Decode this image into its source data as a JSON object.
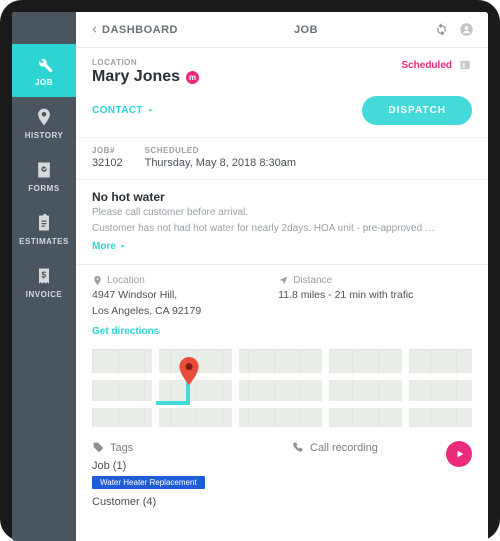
{
  "topbar": {
    "back": "DASHBOARD",
    "title": "JOB"
  },
  "sidebar": {
    "items": [
      {
        "label": "JOB"
      },
      {
        "label": "HISTORY"
      },
      {
        "label": "FORMS"
      },
      {
        "label": "ESTIMATES"
      },
      {
        "label": "INVOICE"
      }
    ]
  },
  "header": {
    "location_label": "LOCATION",
    "customer_name": "Mary Jones",
    "badge_letter": "m",
    "status": "Scheduled",
    "contact": "CONTACT",
    "dispatch": "DISPATCH"
  },
  "meta": {
    "jobnum_label": "JOB#",
    "jobnum": "32102",
    "scheduled_label": "SCHEDULED",
    "scheduled": "Thursday, May 8, 2018 8:30am"
  },
  "desc": {
    "title": "No hot water",
    "line1": "Please call customer before arrival.",
    "line2": "Customer has not had hot water for nearly 2days. HOA unit - pre-approved …",
    "more": "More"
  },
  "location": {
    "loc_label": "Location",
    "address1": "4947 Windsor Hill,",
    "address2": "Los Angeles, CA 92179",
    "dist_label": "Distance",
    "distance": "11.8 miles - 21 min with trafic",
    "directions": "Get directions"
  },
  "tags": {
    "tags_label": "Tags",
    "job_label": "Job (1)",
    "job_tag1": "Water Heater Replacement",
    "customer_label": "Customer (4)",
    "call_label": "Call recording"
  }
}
